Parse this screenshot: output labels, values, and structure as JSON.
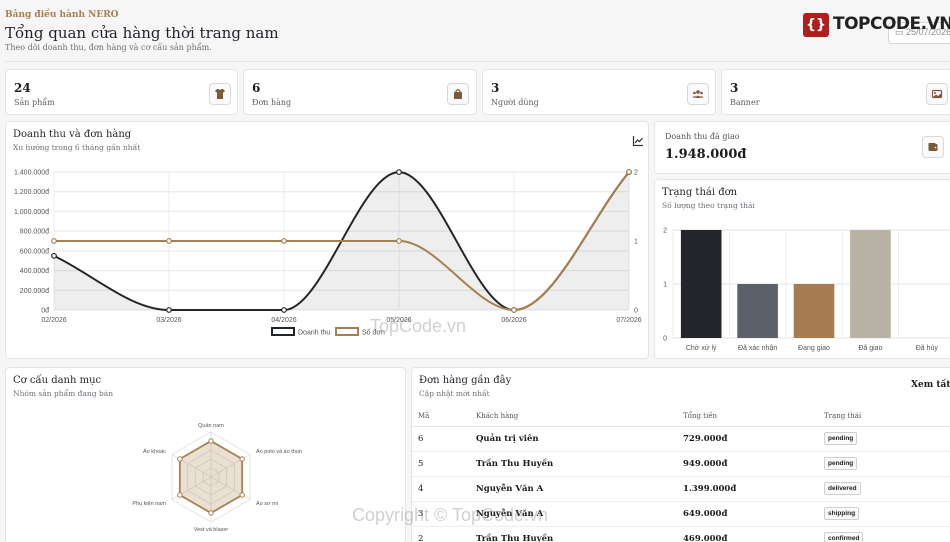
{
  "header": {
    "eyebrow": "Bảng điều hành NERO",
    "title": "Tổng quan cửa hàng thời trang nam",
    "subtitle": "Theo dõi doanh thu, đơn hàng và cơ cấu sản phẩm.",
    "date": "25/07/2026",
    "brand_mark": "{}",
    "brand_name": "TOPCODE.VN"
  },
  "stats": [
    {
      "value": "24",
      "label": "Sản phẩm",
      "icon": "shirt-icon"
    },
    {
      "value": "6",
      "label": "Đơn hàng",
      "icon": "bag-icon"
    },
    {
      "value": "3",
      "label": "Người dùng",
      "icon": "users-icon"
    },
    {
      "value": "3",
      "label": "Banner",
      "icon": "image-icon"
    }
  ],
  "revenue_card": {
    "title": "Doanh thu và đơn hàng",
    "subtitle": "Xu hướng trong 6 tháng gần nhất",
    "legend_revenue": "Doanh thu",
    "legend_orders": "Số đơn"
  },
  "delivered_card": {
    "label": "Doanh thu đã giao",
    "value": "1.948.000đ"
  },
  "status_card": {
    "title": "Trạng thái đơn",
    "subtitle": "Số lượng theo trạng thái"
  },
  "category_card": {
    "title": "Cơ cấu danh mục",
    "subtitle": "Nhóm sản phẩm đang bán"
  },
  "orders_card": {
    "title": "Đơn hàng gần đây",
    "subtitle": "Cập nhật mới nhất",
    "view_all": "Xem tất cả",
    "columns": [
      "Mã",
      "Khách hàng",
      "Tổng tiền",
      "Trạng thái"
    ],
    "rows": [
      {
        "id": "6",
        "customer": "Quản trị viên",
        "total": "729.000đ",
        "status": "pending"
      },
      {
        "id": "5",
        "customer": "Trần Thu Huyền",
        "total": "949.000đ",
        "status": "pending"
      },
      {
        "id": "4",
        "customer": "Nguyễn Văn A",
        "total": "1.399.000đ",
        "status": "delivered"
      },
      {
        "id": "3",
        "customer": "Nguyễn Văn A",
        "total": "649.000đ",
        "status": "shipping"
      },
      {
        "id": "2",
        "customer": "Trần Thu Huyền",
        "total": "469.000đ",
        "status": "confirmed"
      }
    ]
  },
  "watermark": {
    "text1": "TopCode.vn",
    "text2": "Copyright © TopCode.vn"
  },
  "colors": {
    "accent": "#a68050",
    "dark": "#22262b",
    "bar_dark": "#22262b",
    "bar_gray": "#5c6068",
    "bar_brown": "#a67c52",
    "bar_beige": "#b9b2a6"
  },
  "chart_data": [
    {
      "type": "line",
      "x": [
        "02/2026",
        "03/2026",
        "04/2026",
        "05/2026",
        "06/2026",
        "07/2026"
      ],
      "series": [
        {
          "name": "Doanh thu",
          "axis": "left",
          "values": [
            549000,
            0,
            0,
            1399000,
            0,
            1399000
          ],
          "fill": true,
          "color": "#22262b"
        },
        {
          "name": "Số đơn",
          "axis": "right",
          "values": [
            1,
            1,
            1,
            1,
            0,
            2
          ],
          "color": "#a68050"
        }
      ],
      "y_ticks": [
        "0đ",
        "200.000đ",
        "400.000đ",
        "600.000đ",
        "800.000đ",
        "1.000.000đ",
        "1.200.000đ",
        "1.400.000đ"
      ],
      "ylim": [
        0,
        1400000
      ],
      "y2_ticks": [
        "0",
        "1",
        "2"
      ],
      "y2lim": [
        0,
        2
      ],
      "grid": true,
      "legend": "bottom"
    },
    {
      "type": "bar",
      "categories": [
        "Chờ xử lý",
        "Đã xác nhận",
        "Đang giao",
        "Đã giao",
        "Đã hủy"
      ],
      "values": [
        2,
        1,
        1,
        2,
        0
      ],
      "colors": [
        "#22262b",
        "#5c6068",
        "#a67c52",
        "#b9b2a6",
        "#cccccc"
      ],
      "y_ticks": [
        "0",
        "1",
        "2"
      ],
      "ylim": [
        0,
        2
      ],
      "grid": true
    },
    {
      "type": "radar",
      "categories": [
        "Quần nam",
        "Áo polo và áo thun",
        "Áo sơ mi",
        "Vest và blazer",
        "Phụ kiện nam",
        "Áo khoác"
      ],
      "values": [
        4,
        4,
        4,
        4,
        4,
        4
      ],
      "rmax": 5,
      "rings": 5
    }
  ]
}
